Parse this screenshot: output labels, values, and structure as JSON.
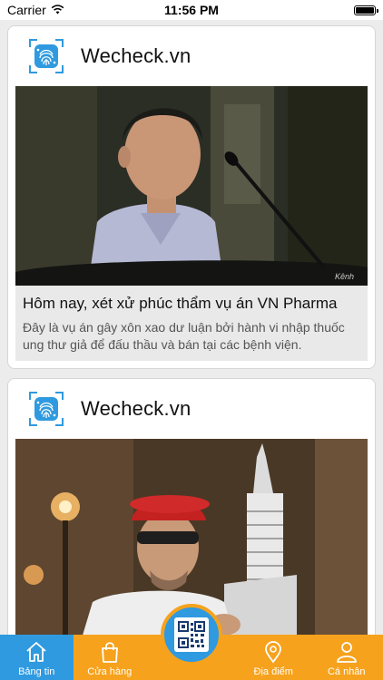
{
  "status_bar": {
    "carrier": "Carrier",
    "time": "11:56 PM"
  },
  "feed": {
    "posts": [
      {
        "source": "Wecheck.vn",
        "title": "Hôm nay, xét xử phúc thẩm vụ án VN Pharma",
        "description": "Đây là vụ án gây xôn xao dư luận bởi hành vi nhập thuốc ung thư giả để đấu thầu và bán tại các bệnh viện."
      },
      {
        "source": "Wecheck.vn"
      }
    ]
  },
  "tab_bar": {
    "items": [
      {
        "label": "Bảng tin",
        "icon": "home-icon"
      },
      {
        "label": "Cửa hàng",
        "icon": "shopping-bag-icon"
      },
      {
        "label": "",
        "icon": "qr-code-icon"
      },
      {
        "label": "Địa điểm",
        "icon": "location-pin-icon"
      },
      {
        "label": "Cá nhân",
        "icon": "person-icon"
      }
    ]
  },
  "colors": {
    "tab_bar": "#f6a21d",
    "tab_active": "#2f9adf",
    "brand_blue": "#2f9adf"
  }
}
